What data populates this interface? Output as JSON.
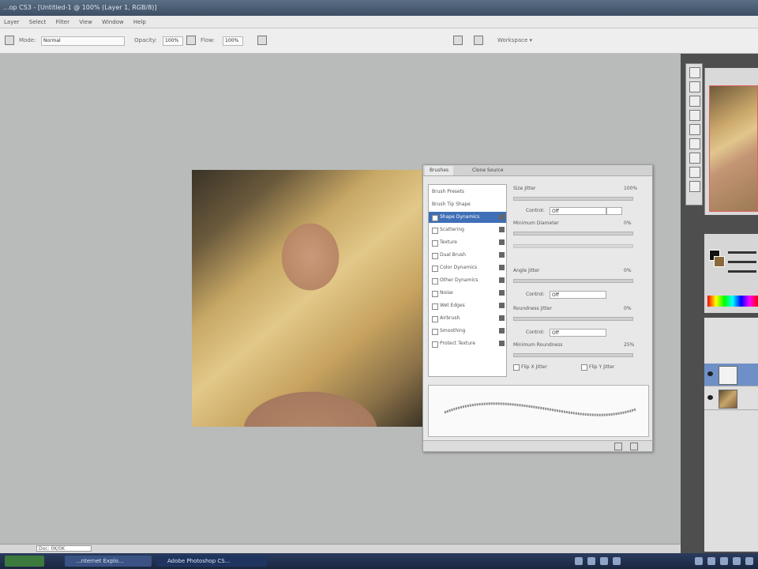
{
  "window": {
    "title": "...op CS3 - [Untitled-1 @ 100% (Layer 1, RGB/8)]"
  },
  "menu": [
    "Layer",
    "Select",
    "Filter",
    "View",
    "Window",
    "Help"
  ],
  "options": {
    "mode_label": "Mode:",
    "mode_value": "Normal",
    "opacity_label": "Opacity:",
    "opacity_value": "100%",
    "flow_label": "Flow:",
    "flow_value": "100%",
    "workspace": "Workspace ▾"
  },
  "brushes_panel": {
    "tabs": [
      "Brushes",
      "Clone Source"
    ],
    "list": [
      {
        "label": "Brush Presets",
        "checkbox": false
      },
      {
        "label": "Brush Tip Shape",
        "checkbox": false
      },
      {
        "label": "Shape Dynamics",
        "checkbox": true,
        "selected": true
      },
      {
        "label": "Scattering",
        "checkbox": true
      },
      {
        "label": "Texture",
        "checkbox": true
      },
      {
        "label": "Dual Brush",
        "checkbox": true
      },
      {
        "label": "Color Dynamics",
        "checkbox": true
      },
      {
        "label": "Other Dynamics",
        "checkbox": true
      },
      {
        "label": "Noise",
        "checkbox": true
      },
      {
        "label": "Wet Edges",
        "checkbox": true
      },
      {
        "label": "Airbrush",
        "checkbox": true
      },
      {
        "label": "Smoothing",
        "checkbox": true
      },
      {
        "label": "Protect Texture",
        "checkbox": true
      }
    ],
    "settings": {
      "size_jitter": "Size Jitter",
      "size_jitter_value": "100%",
      "control": "Control:",
      "control_value": "Off",
      "min_diameter": "Minimum Diameter",
      "min_diameter_value": "0%",
      "angle_jitter": "Angle Jitter",
      "angle_jitter_value": "0%",
      "roundness_jitter": "Roundness Jitter",
      "roundness_jitter_value": "0%",
      "min_roundness": "Minimum Roundness",
      "min_roundness_value": "25%",
      "flip_x": "Flip X Jitter",
      "flip_y": "Flip Y Jitter"
    }
  },
  "status": {
    "zoom": "Doc: 0K/0K"
  },
  "taskbar": {
    "items": [
      "...nternet Explo...",
      "Adobe Photoshop CS..."
    ]
  },
  "colors": {
    "title_bar": "#3d4f63",
    "canvas_bg": "#b8bbb9",
    "selection": "#3f6fb6",
    "dock": "#4e4e4e"
  }
}
